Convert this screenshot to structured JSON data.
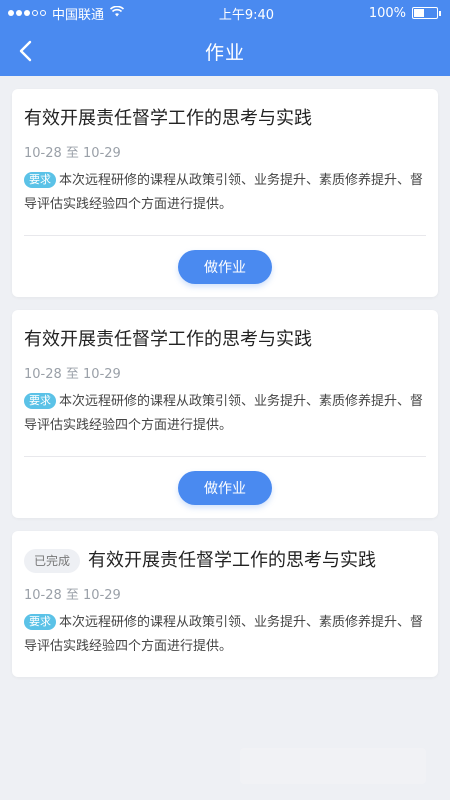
{
  "status_bar": {
    "carrier": "中国联通",
    "time": "上午9:40",
    "battery": "100%"
  },
  "nav": {
    "title": "作业",
    "back_icon": "chevron-left-icon"
  },
  "assignments": [
    {
      "title": "有效开展责任督学工作的思考与实践",
      "date": "10-28 至 10-29",
      "req_label": "要求",
      "description": "本次远程研修的课程从政策引领、业务提升、素质修养提升、督导评估实践经验四个方面进行提供。",
      "button_label": "做作业",
      "completed_label": ""
    },
    {
      "title": "有效开展责任督学工作的思考与实践",
      "date": "10-28 至 10-29",
      "req_label": "要求",
      "description": "本次远程研修的课程从政策引领、业务提升、素质修养提升、督导评估实践经验四个方面进行提供。",
      "button_label": "做作业",
      "completed_label": ""
    },
    {
      "title": "有效开展责任督学工作的思考与实践",
      "date": "10-28 至 10-29",
      "req_label": "要求",
      "description": "本次远程研修的课程从政策引领、业务提升、素质修养提升、督导评估实践经验四个方面进行提供。",
      "button_label": "",
      "completed_label": "已完成"
    }
  ],
  "colors": {
    "primary": "#4a8af0",
    "badge": "#5bc2e7",
    "background": "#eef0f4"
  }
}
